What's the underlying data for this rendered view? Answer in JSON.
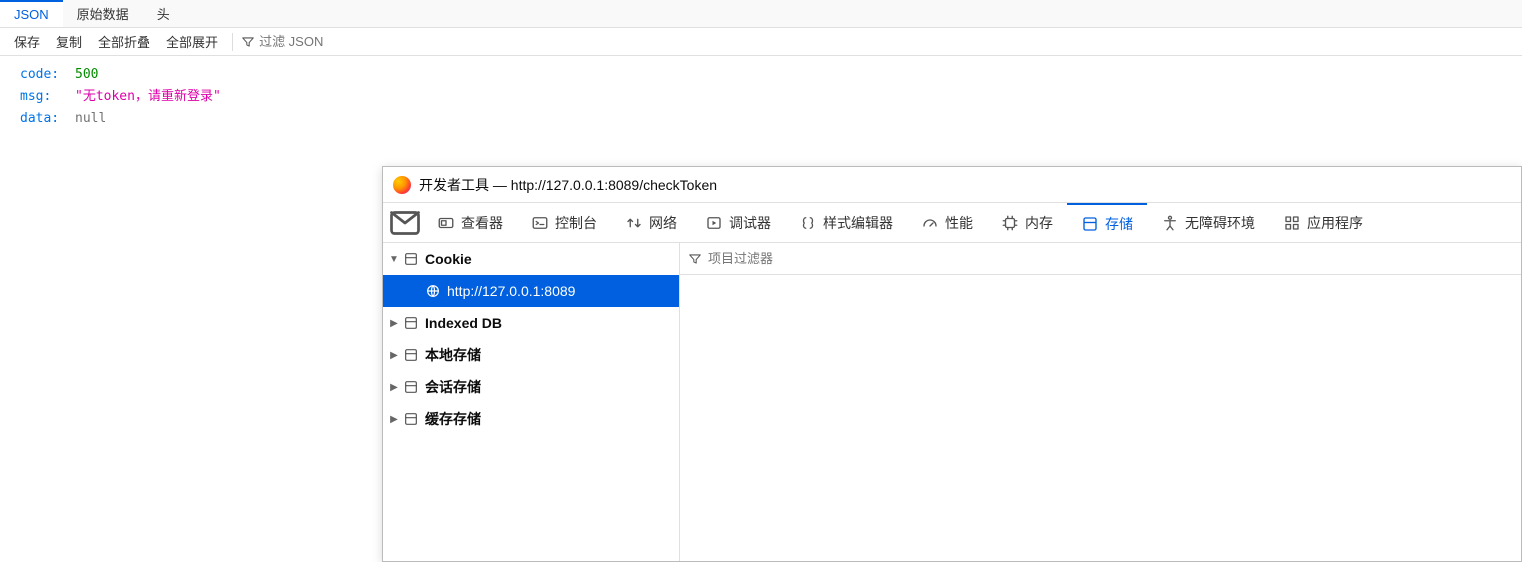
{
  "json_viewer": {
    "tabs": {
      "json": "JSON",
      "raw": "原始数据",
      "headers": "头"
    },
    "toolbar": {
      "save": "保存",
      "copy": "复制",
      "collapse_all": "全部折叠",
      "expand_all": "全部展开",
      "filter_placeholder": "过滤 JSON"
    },
    "data": {
      "code_key": "code:",
      "code_val": "500",
      "msg_key": "msg:",
      "msg_val": "\"无token，请重新登录\"",
      "data_key": "data:",
      "data_val": "null"
    }
  },
  "devtools": {
    "title_prefix": "开发者工具 — ",
    "url": "http://127.0.0.1:8089/checkToken",
    "tool_tabs": {
      "inspector": "查看器",
      "console": "控制台",
      "network": "网络",
      "debugger": "调试器",
      "style": "样式编辑器",
      "performance": "性能",
      "memory": "内存",
      "storage": "存储",
      "accessibility": "无障碍环境",
      "application": "应用程序"
    },
    "sidebar": {
      "cookie": "Cookie",
      "cookie_host": "http://127.0.0.1:8089",
      "indexeddb": "Indexed DB",
      "local": "本地存储",
      "session": "会话存储",
      "cache": "缓存存储"
    },
    "filter_placeholder": "项目过滤器"
  }
}
